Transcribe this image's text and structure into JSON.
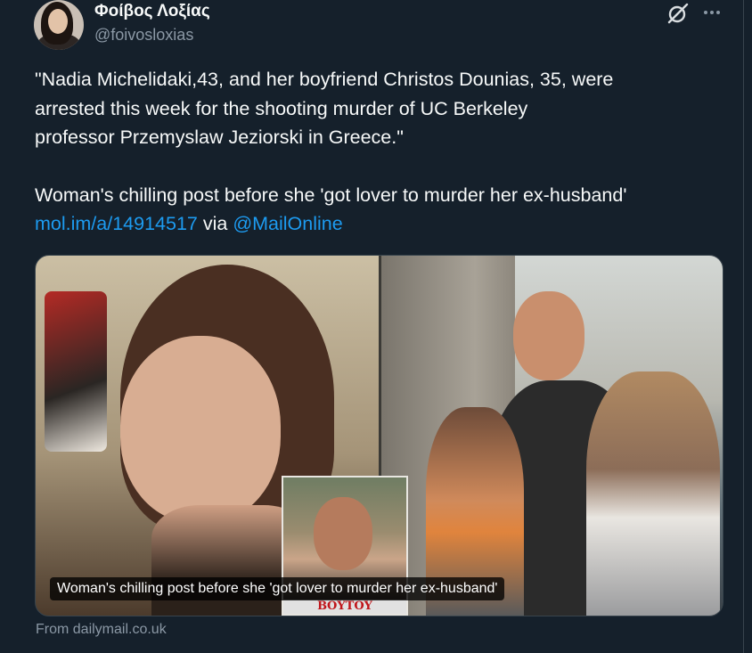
{
  "author": {
    "display_name": "Φοίβος Λοξίας",
    "handle": "@foivosloxias"
  },
  "tweet": {
    "quote_line_1": "\"Nadia Michelidaki,43, and her boyfriend Christos Dounias, 35, were",
    "quote_line_2": "arrested this week for the shooting murder of UC Berkeley",
    "quote_line_3": "professor Przemyslaw Jeziorski in Greece.\"",
    "headline": "Woman's chilling post before she 'got lover to murder her ex-husband'",
    "link_text": "mol.im/a/14914517",
    "via_text": " via ",
    "mention": "@MailOnline"
  },
  "icons": {
    "grok": "grok-icon",
    "more": "more-dots-icon"
  },
  "card": {
    "caption": "Woman's chilling post before she 'got lover to murder her ex-husband'",
    "inset_label": "ΒΟΥΤΟΥ",
    "source": "From dailymail.co.uk"
  },
  "colors": {
    "background": "#15202b",
    "text": "#f7f9f9",
    "secondary": "#8b98a5",
    "link": "#1d9bf0"
  }
}
